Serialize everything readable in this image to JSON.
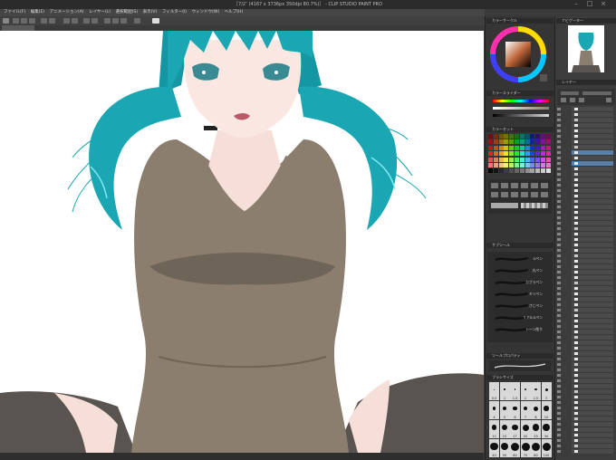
{
  "window": {
    "title": "［7/2″ (4167 x 3736px 350dpi 80.7%)］ - CLIP STUDIO PAINT PRO"
  },
  "menu": [
    "ファイル(F)",
    "編集(E)",
    "アニメーション(A)",
    "レイヤー(L)",
    "選択範囲(S)",
    "表示(V)",
    "フィルター(I)",
    "ウィンドウ(W)",
    "ヘルプ(H)"
  ],
  "panels": {
    "color_wheel": "カラーサークル",
    "color_slider": "カラースライダー",
    "color_set": "カラーセット",
    "tool_property": "ツールプロパティ",
    "sub_tool": "サブツール",
    "brush_size": "ブラシサイズ",
    "navigator": "ナビゲーター",
    "layer": "レイヤー"
  },
  "brushes": [
    "Gペン",
    "丸ペン",
    "カブラペン",
    "ミリペン",
    "さじペン",
    "リアルGペン",
    "トーン削り"
  ],
  "brush_sizes": [
    "0.5",
    "1",
    "1.5",
    "2",
    "2.5",
    "3",
    "4",
    "5",
    "6",
    "7",
    "8",
    "10",
    "12",
    "15",
    "17",
    "20",
    "25",
    "30",
    "40",
    "50",
    "60",
    "70",
    "80",
    "100"
  ],
  "colors": {
    "bg": "#3a3a3a",
    "panel": "#353535",
    "canvas": "#ffffff",
    "hair": "#1aa6b2",
    "shirt": "#8b7e6f",
    "stocking": "#5a5450",
    "skin": "#f6dfd9"
  }
}
